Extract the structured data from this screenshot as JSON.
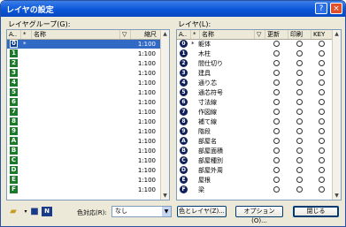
{
  "window": {
    "title": "レイヤの設定",
    "help_label": "?",
    "close_label": "×"
  },
  "left_panel": {
    "label": "レイヤグループ(G):",
    "columns": [
      "A..",
      "*",
      "名称",
      "▽",
      "縮尺"
    ],
    "rows": [
      {
        "badge": "0",
        "star": "*",
        "scale": "1:100",
        "selected": true
      },
      {
        "badge": "1",
        "star": "",
        "scale": "1:100"
      },
      {
        "badge": "2",
        "star": "",
        "scale": "1:100"
      },
      {
        "badge": "3",
        "star": "",
        "scale": "1:100"
      },
      {
        "badge": "4",
        "star": "",
        "scale": "1:100"
      },
      {
        "badge": "5",
        "star": "",
        "scale": "1:100"
      },
      {
        "badge": "6",
        "star": "",
        "scale": "1:100"
      },
      {
        "badge": "7",
        "star": "",
        "scale": "1:100"
      },
      {
        "badge": "8",
        "star": "",
        "scale": "1:100"
      },
      {
        "badge": "9",
        "star": "",
        "scale": "1:100"
      },
      {
        "badge": "A",
        "star": "",
        "scale": "1:100"
      },
      {
        "badge": "B",
        "star": "",
        "scale": "1:100"
      },
      {
        "badge": "C",
        "star": "",
        "scale": "1:100"
      },
      {
        "badge": "D",
        "star": "",
        "scale": "1:100"
      },
      {
        "badge": "E",
        "star": "",
        "scale": "1:100"
      },
      {
        "badge": "F",
        "star": "",
        "scale": "1:100"
      }
    ]
  },
  "right_panel": {
    "label": "レイヤ(L):",
    "columns": [
      "A..",
      "*",
      "名称",
      "▽",
      "更新",
      "印刷",
      "KEY"
    ],
    "rows": [
      {
        "badge": "0",
        "star": "*",
        "name": "躯体"
      },
      {
        "badge": "1",
        "star": "",
        "name": "木柱"
      },
      {
        "badge": "2",
        "star": "",
        "name": "間仕切り"
      },
      {
        "badge": "3",
        "star": "",
        "name": "建具"
      },
      {
        "badge": "4",
        "star": "",
        "name": "通り芯"
      },
      {
        "badge": "5",
        "star": "",
        "name": "通芯符号"
      },
      {
        "badge": "6",
        "star": "",
        "name": "寸法線"
      },
      {
        "badge": "7",
        "star": "",
        "name": "作図線"
      },
      {
        "badge": "8",
        "star": "",
        "name": "補て線"
      },
      {
        "badge": "9",
        "star": "",
        "name": "階段"
      },
      {
        "badge": "A",
        "star": "",
        "name": "部屋名"
      },
      {
        "badge": "B",
        "star": "",
        "name": "部屋面積"
      },
      {
        "badge": "C",
        "star": "",
        "name": "部屋種別"
      },
      {
        "badge": "D",
        "star": "",
        "name": "部屋外周"
      },
      {
        "badge": "E",
        "star": "",
        "name": "屋根"
      },
      {
        "badge": "F",
        "star": "",
        "name": "梁"
      }
    ]
  },
  "bottom": {
    "color_label": "色対応(R):",
    "color_value": "なし",
    "color_layer_button": "色とレイヤ(Z)...",
    "options_button": "オプション(O)...",
    "close_button": "閉じる"
  },
  "colors": {
    "group_badge": "#1a7a2a",
    "layer_badge": "#10205a",
    "selection": "#316ac5"
  }
}
